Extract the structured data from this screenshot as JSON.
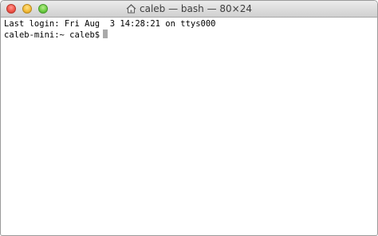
{
  "window": {
    "title": "caleb — bash — 80×24",
    "icon": "home-folder-icon"
  },
  "terminal": {
    "lines": [
      "Last login: Fri Aug  3 14:28:21 on ttys000"
    ],
    "prompt": "caleb-mini:~ caleb$"
  },
  "colors": {
    "background": "#ffffff",
    "text": "#000000",
    "cursor": "#a9a9a9"
  }
}
